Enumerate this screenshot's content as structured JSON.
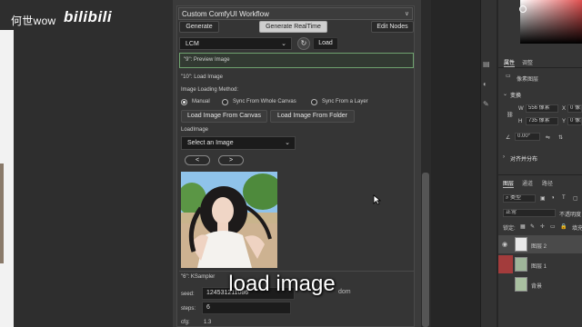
{
  "watermark": {
    "user": "何世wow",
    "site": "bilibili"
  },
  "panel": {
    "title": "Custom ComfyUI Workflow",
    "collapse_glyph": "∨",
    "buttons": {
      "generate": "Generate",
      "generate_realtime": "Generate RealTime",
      "edit_nodes": "Edit Nodes"
    },
    "model_select": "LCM",
    "load_button": "Load",
    "preview_node": "\"9\": Preview Image",
    "load_node": {
      "title": "\"10\": Load Image",
      "method_label": "Image Loading Method:",
      "methods": [
        "Manual",
        "Sync From Whole Canvas",
        "Sync From a Layer"
      ],
      "selected_method": "Manual",
      "load_from_canvas": "Load Image From Canvas",
      "load_from_folder": "Load Image From Folder",
      "loadimage_label": "LoadImage",
      "image_select": "Select an Image",
      "prev": "<",
      "next": ">"
    },
    "sampler_node": {
      "title": "\"6\": KSampler",
      "seed_label": "seed:",
      "seed_value": "124531211086",
      "seed_extra": "dom",
      "steps_label": "steps:",
      "steps_value": "6",
      "cfg_label": "cfg:",
      "cfg_value": "1.3"
    }
  },
  "subtitle": "load image",
  "photoshop": {
    "tabs_top": [
      "属性",
      "调整"
    ],
    "pixel_layer": "像素图层",
    "transform_label": "变换",
    "w_label": "W",
    "w_value": "556 像素",
    "h_label": "H",
    "h_value": "735 像素",
    "x_label": "X",
    "x_value": "0 像素",
    "y_label": "Y",
    "y_value": "0 像素",
    "angle_value": "0.00°",
    "align_label": "对齐并分布",
    "layer_tabs": [
      "图层",
      "通道",
      "路径"
    ],
    "filter_kind": "类型",
    "blend_mode": "正常",
    "opacity_label": "不透明度",
    "lock_label": "锁定:",
    "fill_label": "填充",
    "layers": [
      "图层 2",
      "图层 1",
      "背景"
    ]
  }
}
